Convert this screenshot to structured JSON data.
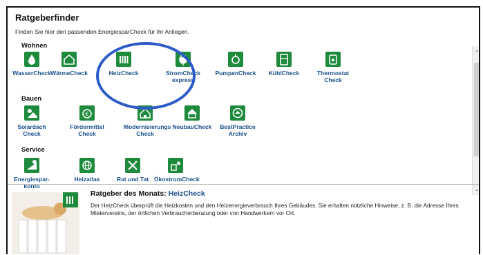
{
  "header": {
    "title": "Ratgeberfinder",
    "subtitle": "Finden Sie hier den passenden EnergiesparCheck für Ihr Anliegen."
  },
  "sections": {
    "wohnen": {
      "heading": "Wohnen",
      "items": [
        {
          "label": "WasserCheck",
          "icon": "water-drop-icon"
        },
        {
          "label": "WärmeCheck",
          "icon": "house-heat-icon"
        },
        {
          "label": "HeizCheck",
          "icon": "radiator-icon"
        },
        {
          "label": "StromCheck",
          "label2": "express",
          "icon": "plug-icon"
        },
        {
          "label": "PumpenCheck",
          "icon": "pump-icon"
        },
        {
          "label": "KühlCheck",
          "icon": "fridge-icon"
        },
        {
          "label": "Thermostat",
          "label2": "Check",
          "icon": "thermostat-icon"
        }
      ]
    },
    "bauen": {
      "heading": "Bauen",
      "items": [
        {
          "label": "Solardach",
          "label2": "Check",
          "icon": "solar-roof-icon"
        },
        {
          "label": "Fördermittel",
          "label2": "Check",
          "icon": "funding-icon"
        },
        {
          "label": "Modernisierungs",
          "label2": "Check",
          "icon": "modernization-icon"
        },
        {
          "label": "NeubauCheck",
          "icon": "new-building-icon"
        },
        {
          "label": "BestPractice",
          "label2": "Archiv",
          "icon": "best-practice-icon"
        }
      ]
    },
    "service": {
      "heading": "Service",
      "items": [
        {
          "label": "Energiespar-",
          "label2": "konto",
          "icon": "energy-account-icon"
        },
        {
          "label": "Heizatlas",
          "icon": "globe-icon"
        },
        {
          "label": "Rat und Tat",
          "icon": "tools-icon"
        },
        {
          "label": "ÖkostromCheck",
          "icon": "green-power-icon"
        }
      ]
    }
  },
  "advisor_of_month": {
    "title_prefix": "Ratgeber des Monats:",
    "title_link": "HeizCheck",
    "text": "Der HeizCheck überprüft die Heizkosten und den Heizenergieverbrauch Ihres Gebäudes. Sie erhalten nützliche Hinweise, z. B. die Adresse Ihres Mietervereins, der örtlichen Verbraucherberatung oder von Handwerkern vor Ort."
  },
  "colors": {
    "tile_green": "#1e8a3c",
    "link_blue": "#1a4f8a",
    "highlight_circle": "#2c5bc8"
  }
}
